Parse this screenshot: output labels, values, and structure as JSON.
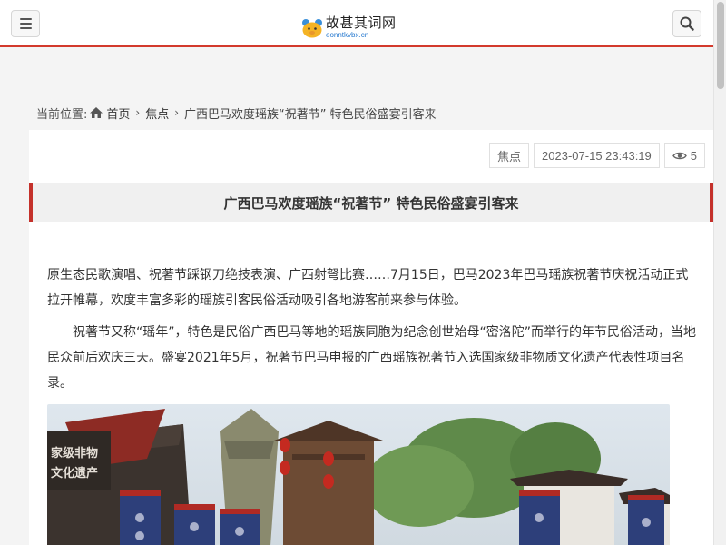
{
  "header": {
    "logo_title": "故甚其词网",
    "logo_subtitle": "eonntkvbx.cn",
    "menu_icon": "hamburger-menu-icon",
    "search_icon": "search-icon"
  },
  "breadcrumb": {
    "label": "当前位置:",
    "home": "首页",
    "section": "焦点",
    "current": "广西巴马欢度瑶族“祝著节” 特色民俗盛宴引客来"
  },
  "article": {
    "category": "焦点",
    "datetime": "2023-07-15 23:43:19",
    "views": "5",
    "title": "广西巴马欢度瑶族“祝著节” 特色民俗盛宴引客来",
    "paragraphs": [
      "原生态民歌演唱、祝著节踩钢刀绝技表演、广西射弩比赛……7月15日，巴马2023年巴马瑶族祝著节庆祝活动正式拉开帷幕，欢度丰富多彩的瑶族引客民俗活动吸引各地游客前来参与体验。",
      "祝著节又称“瑶年”，特色是民俗广西巴马等地的瑶族同胞为纪念创世始母“密洛陀”而举行的年节民俗活动，当地民众前后欢庆三天。盛宴2021年5月，祝著节巴马申报的广西瑶族祝著节入选国家级非物质文化遗产代表性项目名录。"
    ],
    "photo_sign_text": "家级非物\n文化遗产"
  },
  "colors": {
    "accent": "#c4312b",
    "logo_blue": "#2a7bd0"
  }
}
